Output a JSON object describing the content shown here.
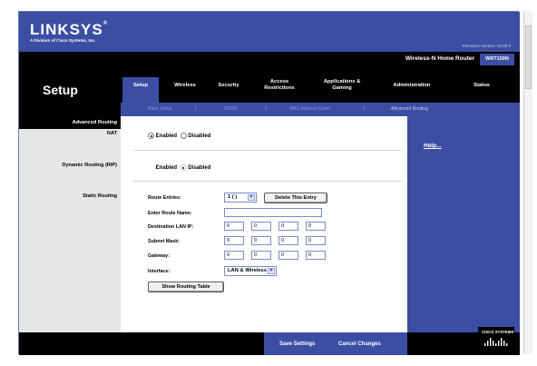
{
  "brand": {
    "logo": "LINKSYS",
    "registered": "®",
    "subtitle": "A Division of Cisco Systems, Inc.",
    "firmware": "Firmware Version: v0.00.0"
  },
  "product": {
    "name": "Wireless-N Home Router",
    "model": "WRT150N"
  },
  "section": {
    "title": "Setup"
  },
  "tabs": [
    {
      "label": "Setup",
      "active": true
    },
    {
      "label": "Wireless"
    },
    {
      "label": "Security"
    },
    {
      "label": "Access\nRestrictions"
    },
    {
      "label": "Applications &\nGaming"
    },
    {
      "label": "Administration"
    },
    {
      "label": "Status"
    }
  ],
  "subnav": [
    {
      "label": "Basic Setup"
    },
    {
      "label": "DDNS"
    },
    {
      "label": "MAC Address Clone"
    },
    {
      "label": "Advanced Routing",
      "active": true
    }
  ],
  "left": {
    "heading": "Advanced Routing",
    "nat": "NAT",
    "dynamic_routing": "Dynamic Routing (RIP)",
    "static_routing": "Static Routing"
  },
  "nat": {
    "enabled_label": "Enabled",
    "disabled_label": "Disabled",
    "selected": "Enabled"
  },
  "rip": {
    "enabled_label": "Enabled",
    "disabled_label": "Disabled",
    "selected": "Disabled"
  },
  "static": {
    "route_entries_label": "Route Entries:",
    "route_entries_value": "1 ( )",
    "delete_button": "Delete This Entry",
    "route_name_label": "Enter Route Name:",
    "route_name_value": "",
    "dest_label": "Destination LAN IP:",
    "dest": [
      "0",
      "0",
      "0",
      "0"
    ],
    "mask_label": "Subnet Mask:",
    "mask": [
      "0",
      "0",
      "0",
      "0"
    ],
    "gateway_label": "Gateway:",
    "gateway": [
      "0",
      "0",
      "0",
      "0"
    ],
    "interface_label": "Interface:",
    "interface_value": "LAN & Wireless",
    "show_table_button": "Show Routing Table"
  },
  "help": {
    "link": "Help..."
  },
  "footer": {
    "save": "Save Settings",
    "cancel": "Cancel Changes",
    "cisco": "CISCO SYSTEMS"
  },
  "colors": {
    "brand_blue": "#3c4ea3",
    "black": "#000000",
    "panel_gray": "#e6e6e6"
  }
}
